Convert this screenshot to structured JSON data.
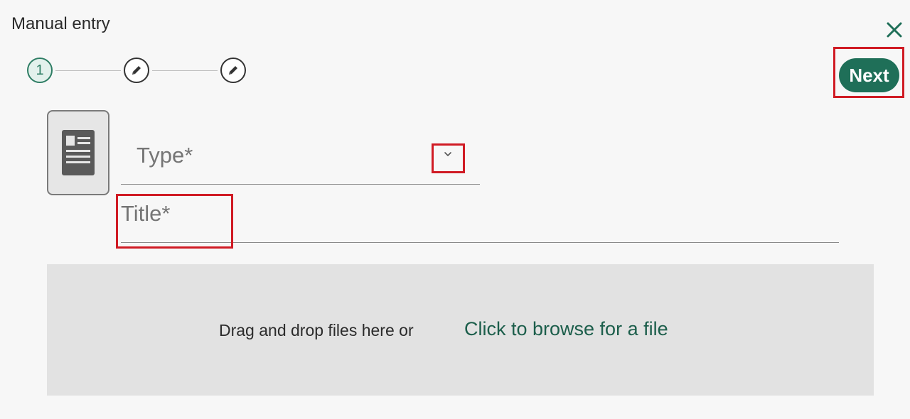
{
  "dialog": {
    "title": "Manual entry",
    "close_icon": "close-icon"
  },
  "stepper": {
    "steps": [
      {
        "label": "1",
        "state": "active"
      },
      {
        "label": "",
        "icon": "pencil-icon",
        "state": "pending"
      },
      {
        "label": "",
        "icon": "pencil-icon",
        "state": "pending"
      }
    ]
  },
  "actions": {
    "next_label": "Next"
  },
  "form": {
    "document_icon": "document-icon",
    "type": {
      "label": "Type*",
      "value": "",
      "icon": "chevron-down-icon"
    },
    "title": {
      "label": "Title*",
      "value": ""
    }
  },
  "dropzone": {
    "text": "Drag and drop files here or",
    "link": "Click to browse for a file"
  },
  "colors": {
    "accent": "#1f6f58",
    "link": "#1c5e4b",
    "highlight": "#d01b24",
    "background": "#f7f7f7",
    "dropzone": "#e2e2e2"
  }
}
